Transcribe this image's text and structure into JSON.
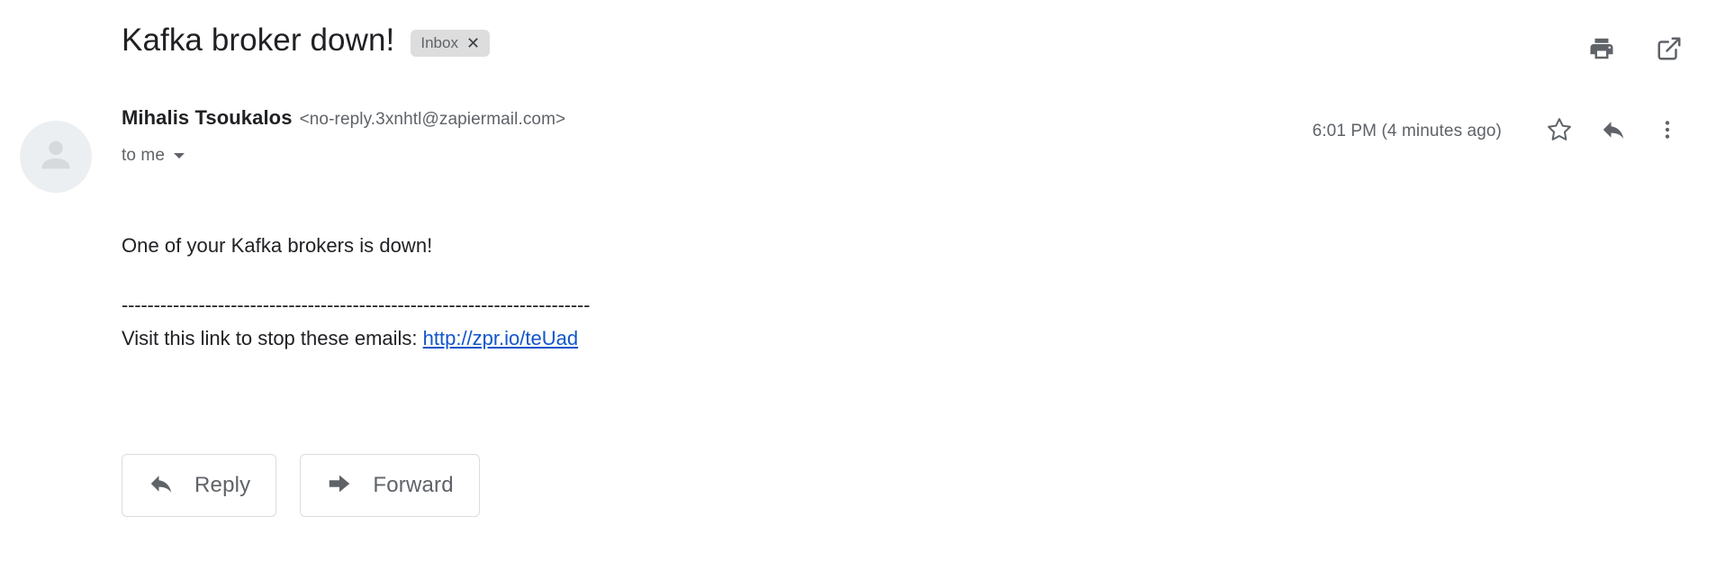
{
  "subject": {
    "title": "Kafka broker down!",
    "label_chip": {
      "text": "Inbox",
      "remove": "✕"
    }
  },
  "header_actions": [
    {
      "name": "print-icon",
      "title": "Print all"
    },
    {
      "name": "open-in-new-icon",
      "title": "Open in new window"
    }
  ],
  "message": {
    "sender_name": "Mihalis Tsoukalos",
    "sender_email": "<no-reply.3xnhtl@zapiermail.com>",
    "recipient": "to me",
    "timestamp": "6:01 PM (4 minutes ago)",
    "avatar": "default-person-avatar"
  },
  "meta_actions": [
    {
      "name": "star-icon",
      "title": "Not starred"
    },
    {
      "name": "reply-arrow-icon",
      "title": "Reply"
    },
    {
      "name": "more-vertical-icon",
      "title": "More"
    }
  ],
  "body": {
    "paragraph": "One of your Kafka brokers is down!",
    "divider": "-------------------------------------------------------------------------",
    "link_prefix": "Visit this link to stop these emails: ",
    "link_text": "http://zpr.io/teUad"
  },
  "footer_buttons": [
    {
      "label": "Reply",
      "icon": "reply-arrow-icon"
    },
    {
      "label": "Forward",
      "icon": "forward-arrow-icon"
    }
  ],
  "colors": {
    "text_primary": "#202124",
    "text_secondary": "#5f6368",
    "link": "#1155cc",
    "chip_bg": "#ddddde",
    "border": "#dadce0",
    "avatar_bg": "#eceff1",
    "background": "#ffffff"
  }
}
